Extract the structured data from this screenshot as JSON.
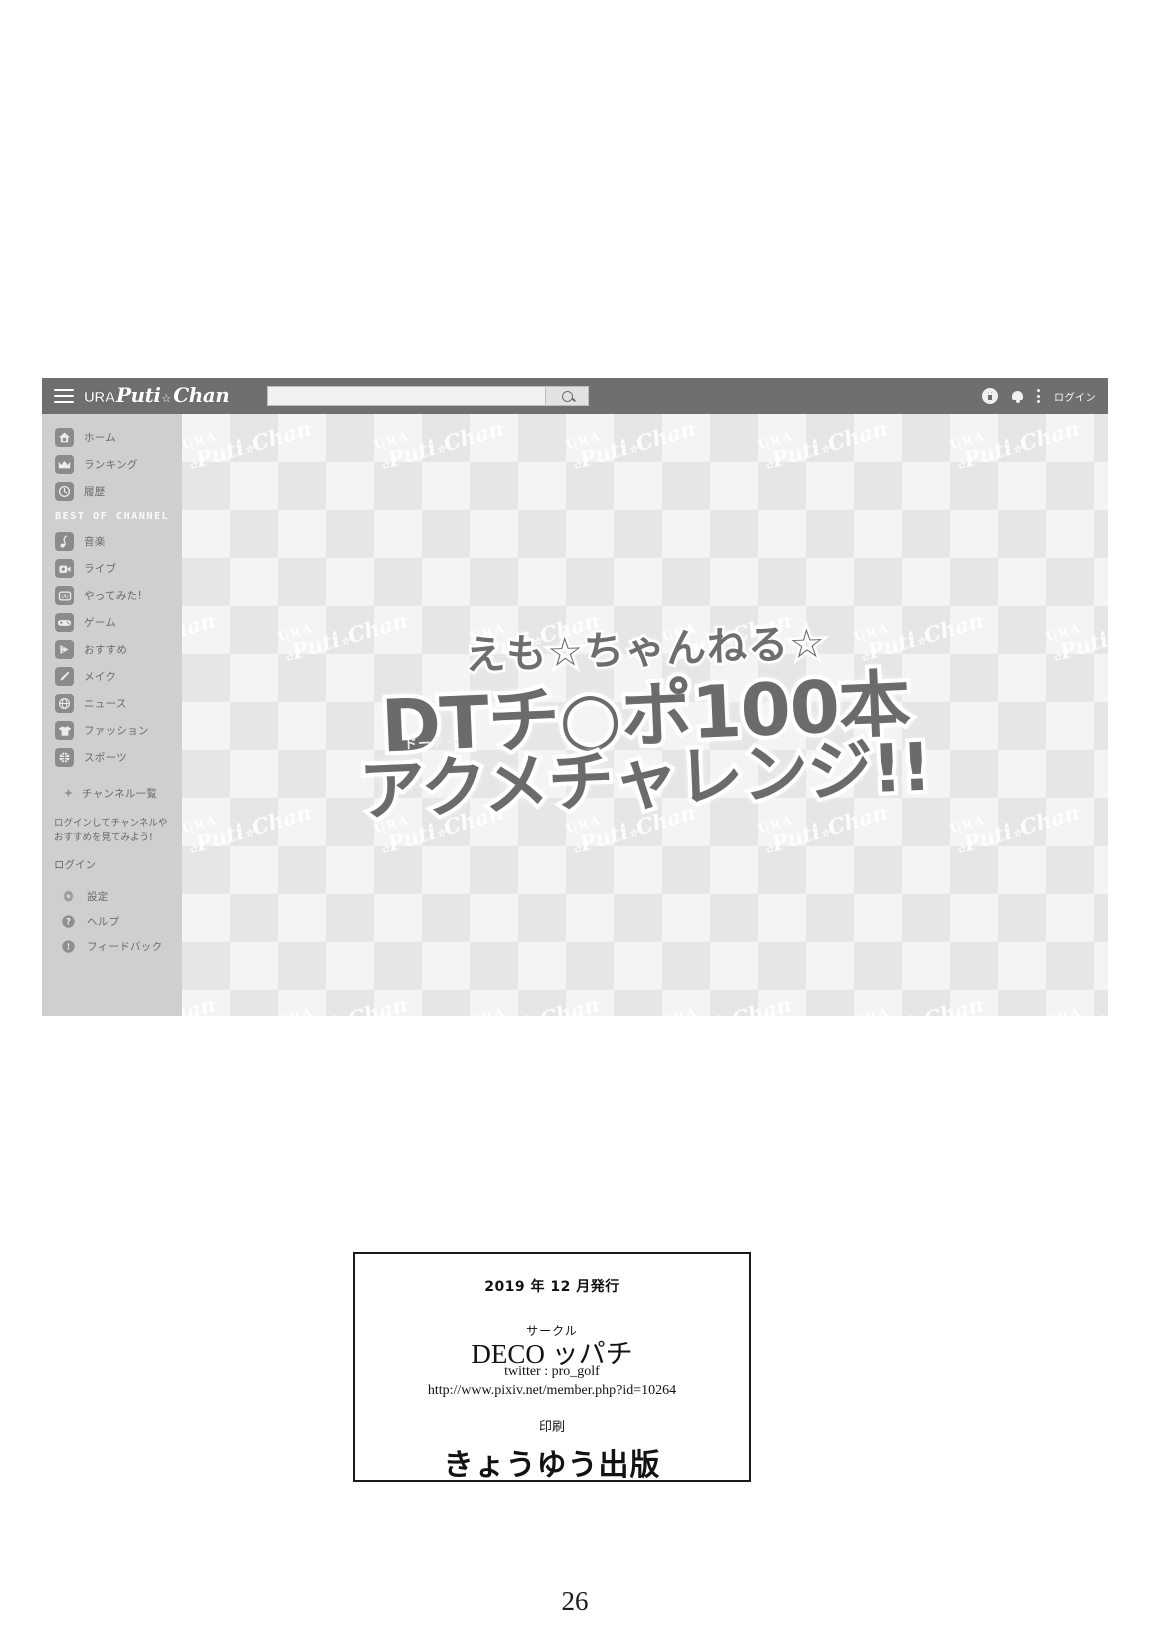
{
  "page": {
    "number": "26"
  },
  "site": {
    "topbar": {
      "menu_icon": "hamburger-icon",
      "brand_prefix": "URA",
      "brand_script": "Puti",
      "brand_script2": "Chan",
      "brand_star": "☆",
      "search": {
        "value": "",
        "placeholder": "",
        "button_icon": "magnifier-icon"
      },
      "upload_icon": "upload-icon",
      "notification_icon": "bell-icon",
      "more_icon": "kebab-menu-icon",
      "login_label": "ログイン"
    },
    "sidebar": {
      "primary": [
        {
          "label": "ホーム",
          "icon": "home-icon",
          "glyph": "⌂"
        },
        {
          "label": "ランキング",
          "icon": "crown-icon",
          "glyph": "♛"
        },
        {
          "label": "履歴",
          "icon": "clock-icon",
          "glyph": "◷"
        }
      ],
      "section_title": "BEST OF CHANNEL",
      "channels": [
        {
          "label": "音楽",
          "icon": "music-note-icon",
          "glyph": "♪"
        },
        {
          "label": "ライブ",
          "icon": "live-camera-icon",
          "glyph": "▣"
        },
        {
          "label": "やってみた!",
          "icon": "try-it-icon",
          "glyph": "⛶"
        },
        {
          "label": "ゲーム",
          "icon": "gamepad-icon",
          "glyph": "🎮"
        },
        {
          "label": "おすすめ",
          "icon": "recommend-play-icon",
          "glyph": "▶"
        },
        {
          "label": "メイク",
          "icon": "makeup-brush-icon",
          "glyph": "✎"
        },
        {
          "label": "ニュース",
          "icon": "globe-news-icon",
          "glyph": "⊕"
        },
        {
          "label": "ファッション",
          "icon": "tshirt-icon",
          "glyph": "👕"
        },
        {
          "label": "スポーツ",
          "icon": "basketball-icon",
          "glyph": "✺"
        }
      ],
      "channel_list_label": "チャンネル一覧",
      "promo_text": "ログインしてチャンネルや\nおすすめを見てみよう!",
      "login_label": "ログイン",
      "utilities": [
        {
          "label": "設定",
          "icon": "gear-icon"
        },
        {
          "label": "ヘルプ",
          "icon": "help-circle-icon"
        },
        {
          "label": "フィードバック",
          "icon": "feedback-info-icon"
        }
      ]
    },
    "content": {
      "watermark_text_ura": "URA",
      "watermark_text_script": "Puti",
      "watermark_text_script2": "Chan",
      "watermark_star": "☆",
      "title_line1": "えも☆ちゃんねる☆",
      "title_line2": "DTチ○ポ100本",
      "title_line2_ruby": "ドーテー",
      "title_line3": "アクメチャレンジ!!"
    }
  },
  "colophon": {
    "publish_date": "2019 年 12 月発行",
    "circle_label": "サークル",
    "circle_name": "DECO ッパチ",
    "twitter": "twitter : pro_golf",
    "url": "http://www.pixiv.net/member.php?id=10264",
    "print_label": "印刷",
    "printer_name": "きょうゆう出版"
  },
  "colors": {
    "topbar": "#6f6f6f",
    "sidebar": "#cfcfcf",
    "checker_light": "#f4f4f4",
    "checker_dark": "#e6e6e6",
    "ink": "#121212"
  }
}
